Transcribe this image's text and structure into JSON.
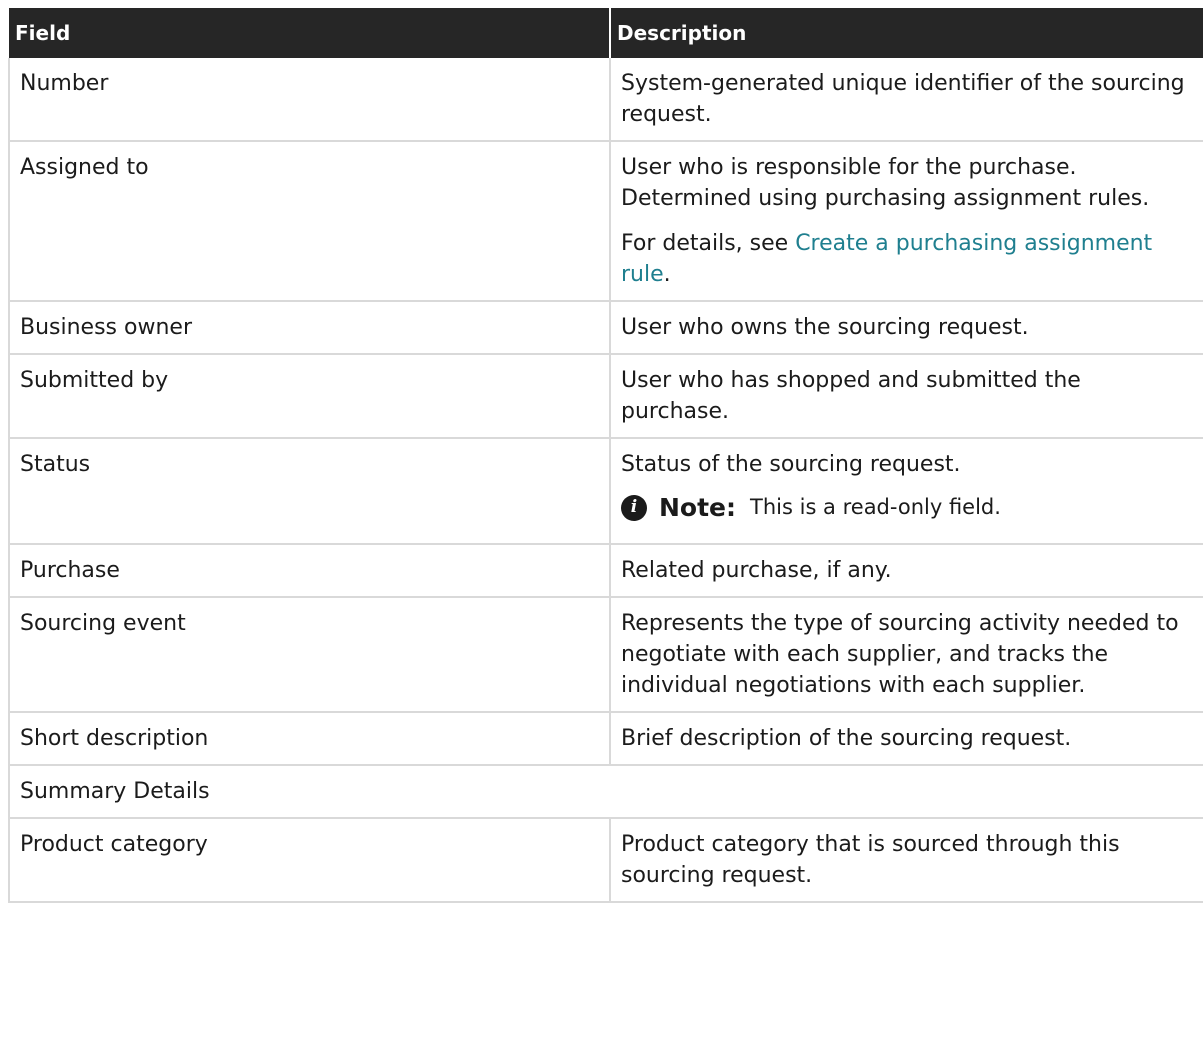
{
  "header": {
    "field": "Field",
    "description": "Description"
  },
  "rows": [
    {
      "field": "Number",
      "description": "System-generated unique identifier of the sourcing request."
    },
    {
      "field": "Assigned to",
      "description": "User who is responsible for the purchase. Determined using purchasing assignment rules.",
      "extra_prefix": "For details, see ",
      "extra_link": "Create a purchasing assignment rule",
      "extra_suffix": "."
    },
    {
      "field": "Business owner",
      "description": "User who owns the sourcing request."
    },
    {
      "field": "Submitted by",
      "description": "User who has shopped and submitted the purchase."
    },
    {
      "field": "Status",
      "description": "Status of the sourcing request.",
      "note_label": "Note:",
      "note_text": "This is a read-only field.",
      "note_icon": "info-icon"
    },
    {
      "field": "Purchase",
      "description": "Related purchase, if any."
    },
    {
      "field": "Sourcing event",
      "description": "Represents the type of sourcing activity needed to negotiate with each supplier, and tracks the individual negotiations with each supplier."
    },
    {
      "field": "Short description",
      "description": "Brief description of the sourcing request."
    }
  ],
  "section": {
    "title": "Summary Details"
  },
  "section_rows": [
    {
      "field": "Product category",
      "description": "Product category that is sourced through this sourcing request."
    }
  ],
  "colors": {
    "header_bg": "#262626",
    "link": "#1f7f8f",
    "border": "#d9d9d9"
  }
}
